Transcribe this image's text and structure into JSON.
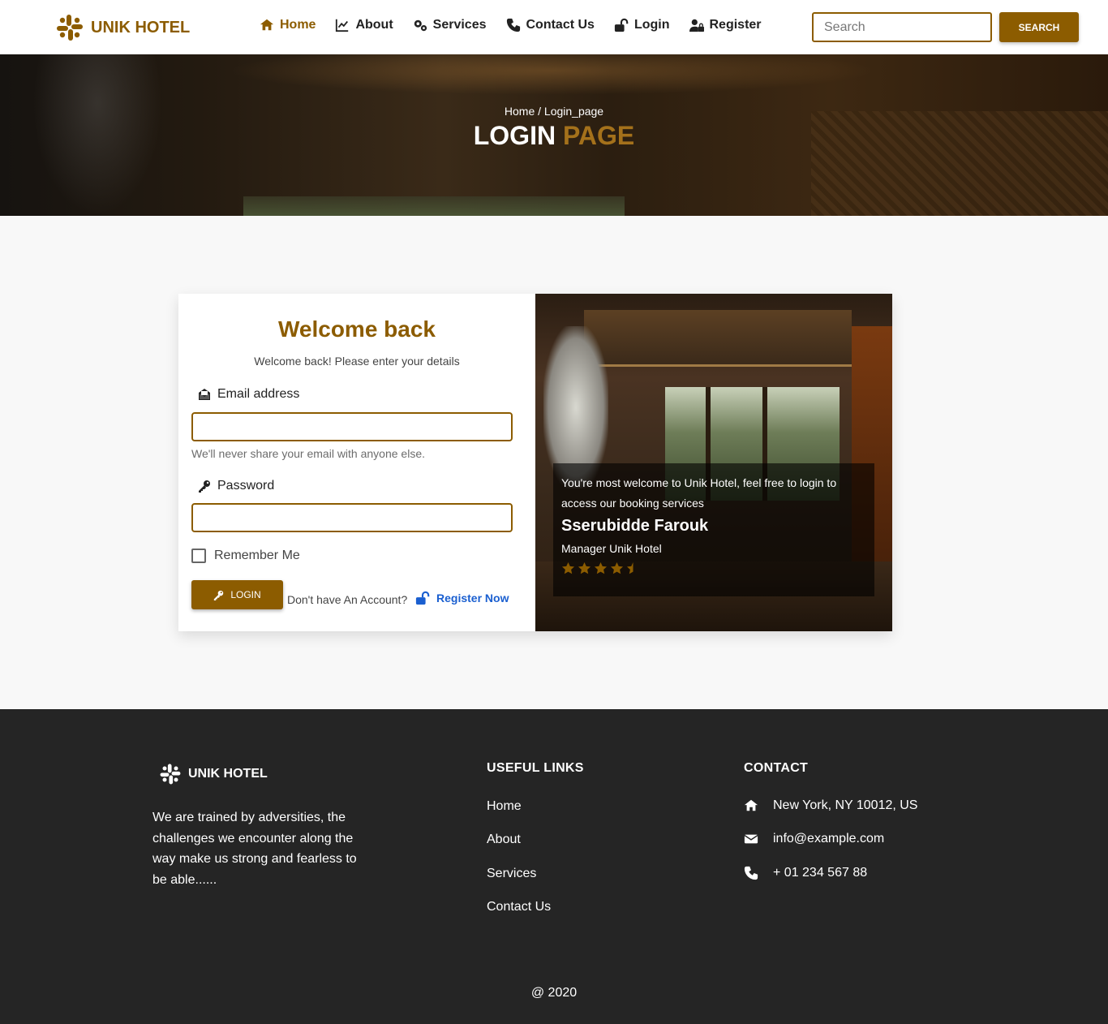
{
  "brand": {
    "name": "UNIK HOTEL"
  },
  "nav": {
    "items": [
      {
        "label": "Home",
        "icon": "home-icon",
        "active": true
      },
      {
        "label": "About",
        "icon": "chart-line-icon"
      },
      {
        "label": "Services",
        "icon": "cogs-icon"
      },
      {
        "label": "Contact Us",
        "icon": "phone-icon"
      },
      {
        "label": "Login",
        "icon": "unlock-icon"
      },
      {
        "label": "Register",
        "icon": "user-lock-icon"
      }
    ],
    "search_placeholder": "Search",
    "search_button": "SEARCH"
  },
  "hero": {
    "breadcrumb": "Home / Login_page",
    "title_main": "LOGIN",
    "title_accent": "PAGE"
  },
  "login": {
    "title": "Welcome back",
    "subtitle": "Welcome back! Please enter your details",
    "email_label": "Email address",
    "email_value": "",
    "email_help": "We'll never share your email with anyone else.",
    "password_label": "Password",
    "password_value": "",
    "remember_label": "Remember Me",
    "remember_checked": false,
    "login_button": "LOGIN",
    "no_account_text": "Don't have An Account?",
    "register_link": "Register Now"
  },
  "testimonial": {
    "quote": "You're most welcome to Unik Hotel, feel free to login to access our booking services",
    "name": "Sserubidde Farouk",
    "role": "Manager Unik Hotel",
    "rating": 4.5,
    "rating_max": 5
  },
  "footer": {
    "brand": "UNIK HOTEL",
    "about": "We are trained by adversities, the challenges we encounter along the way make us strong and fearless to be able......",
    "links_heading": "USEFUL LINKS",
    "links": [
      "Home",
      "About",
      "Services",
      "Contact Us"
    ],
    "contact_heading": "CONTACT",
    "address": "New York, NY 10012, US",
    "email": "info@example.com",
    "phone": "+ 01 234 567 88",
    "copyright": "@ 2020"
  },
  "colors": {
    "brand": "#8c5c00",
    "link": "#1a5fd0",
    "footer_bg": "#252525",
    "page_bg": "#f8f8f8"
  }
}
